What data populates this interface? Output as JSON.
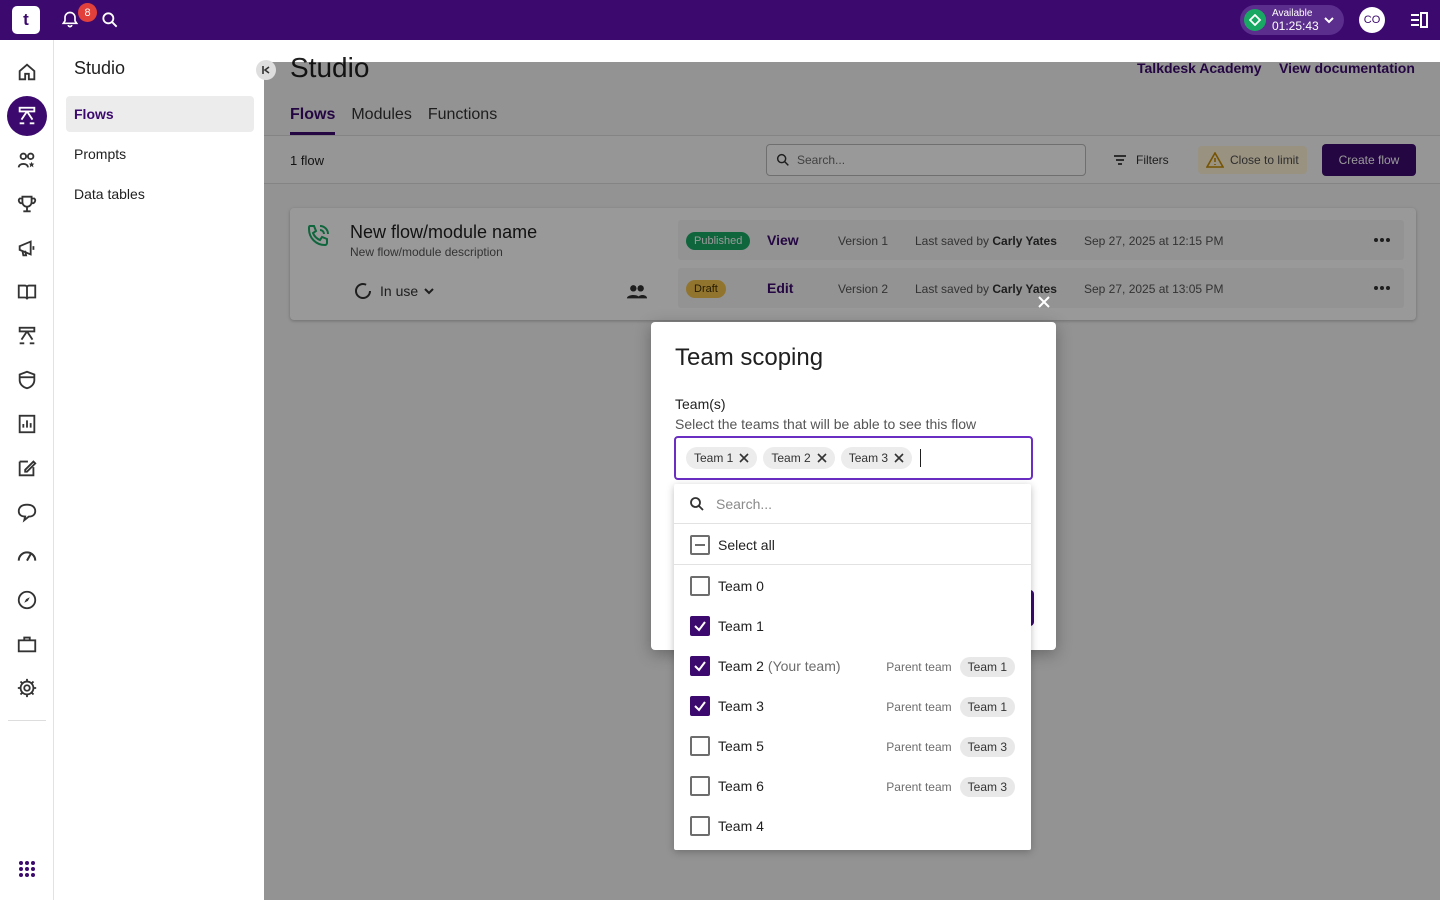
{
  "topbar": {
    "logo": "t",
    "notifications_count": "8",
    "status_label": "Available",
    "status_timer": "01:25:43",
    "avatar_initials": "CO",
    "accent": "#3c0a6e"
  },
  "rail": {
    "icons": [
      "home-icon",
      "studio-icon",
      "users-icon",
      "trophy-icon",
      "megaphone-icon",
      "book-icon",
      "flow-icon",
      "shield-icon",
      "reports-icon",
      "edit-icon",
      "chat-icon",
      "gauge-icon",
      "compass-icon",
      "briefcase-icon",
      "gear-icon",
      "apps-grid-icon"
    ]
  },
  "sidebar": {
    "title": "Studio",
    "items": [
      {
        "label": "Flows",
        "active": true
      },
      {
        "label": "Prompts",
        "active": false
      },
      {
        "label": "Data tables",
        "active": false
      }
    ]
  },
  "main": {
    "title": "Studio",
    "links": [
      "Talkdesk Academy",
      "View documentation"
    ],
    "tabs": [
      {
        "label": "Flows",
        "active": true
      },
      {
        "label": "Modules",
        "active": false
      },
      {
        "label": "Functions",
        "active": false
      }
    ],
    "count_text": "1 flow",
    "search_placeholder": "Search...",
    "filters_label": "Filters",
    "limit_label": "Close to limit",
    "create_label": "Create flow",
    "flow": {
      "name": "New flow/module name",
      "description": "New flow/module description",
      "usage": "In use",
      "versions": [
        {
          "status": "Published",
          "action": "View",
          "version": "Version 1",
          "saved_prefix": "Last saved by",
          "saved_by": "Carly Yates",
          "date": "Sep 27, 2025 at 12:15 PM"
        },
        {
          "status": "Draft",
          "action": "Edit",
          "version": "Version 2",
          "saved_prefix": "Last saved by",
          "saved_by": "Carly Yates",
          "date": "Sep 27, 2025 at 13:05 PM"
        }
      ]
    }
  },
  "modal": {
    "title": "Team scoping",
    "field_label": "Team(s)",
    "help": "Select the teams that will be able to see this flow",
    "chips": [
      "Team 1",
      "Team 2",
      "Team 3"
    ],
    "dropdown": {
      "search_placeholder": "Search...",
      "select_all": "Select all",
      "parent_label": "Parent team",
      "options": [
        {
          "label": "Team 0",
          "extra": "",
          "checked": false,
          "parent": ""
        },
        {
          "label": "Team 1",
          "extra": "",
          "checked": true,
          "parent": ""
        },
        {
          "label": "Team 2",
          "extra": "(Your team)",
          "checked": true,
          "parent": "Team 1"
        },
        {
          "label": "Team 3",
          "extra": "",
          "checked": true,
          "parent": "Team 1"
        },
        {
          "label": "Team 5",
          "extra": "",
          "checked": false,
          "parent": "Team 3"
        },
        {
          "label": "Team 6",
          "extra": "",
          "checked": false,
          "parent": "Team 3"
        },
        {
          "label": "Team 4",
          "extra": "",
          "checked": false,
          "parent": ""
        }
      ]
    }
  }
}
